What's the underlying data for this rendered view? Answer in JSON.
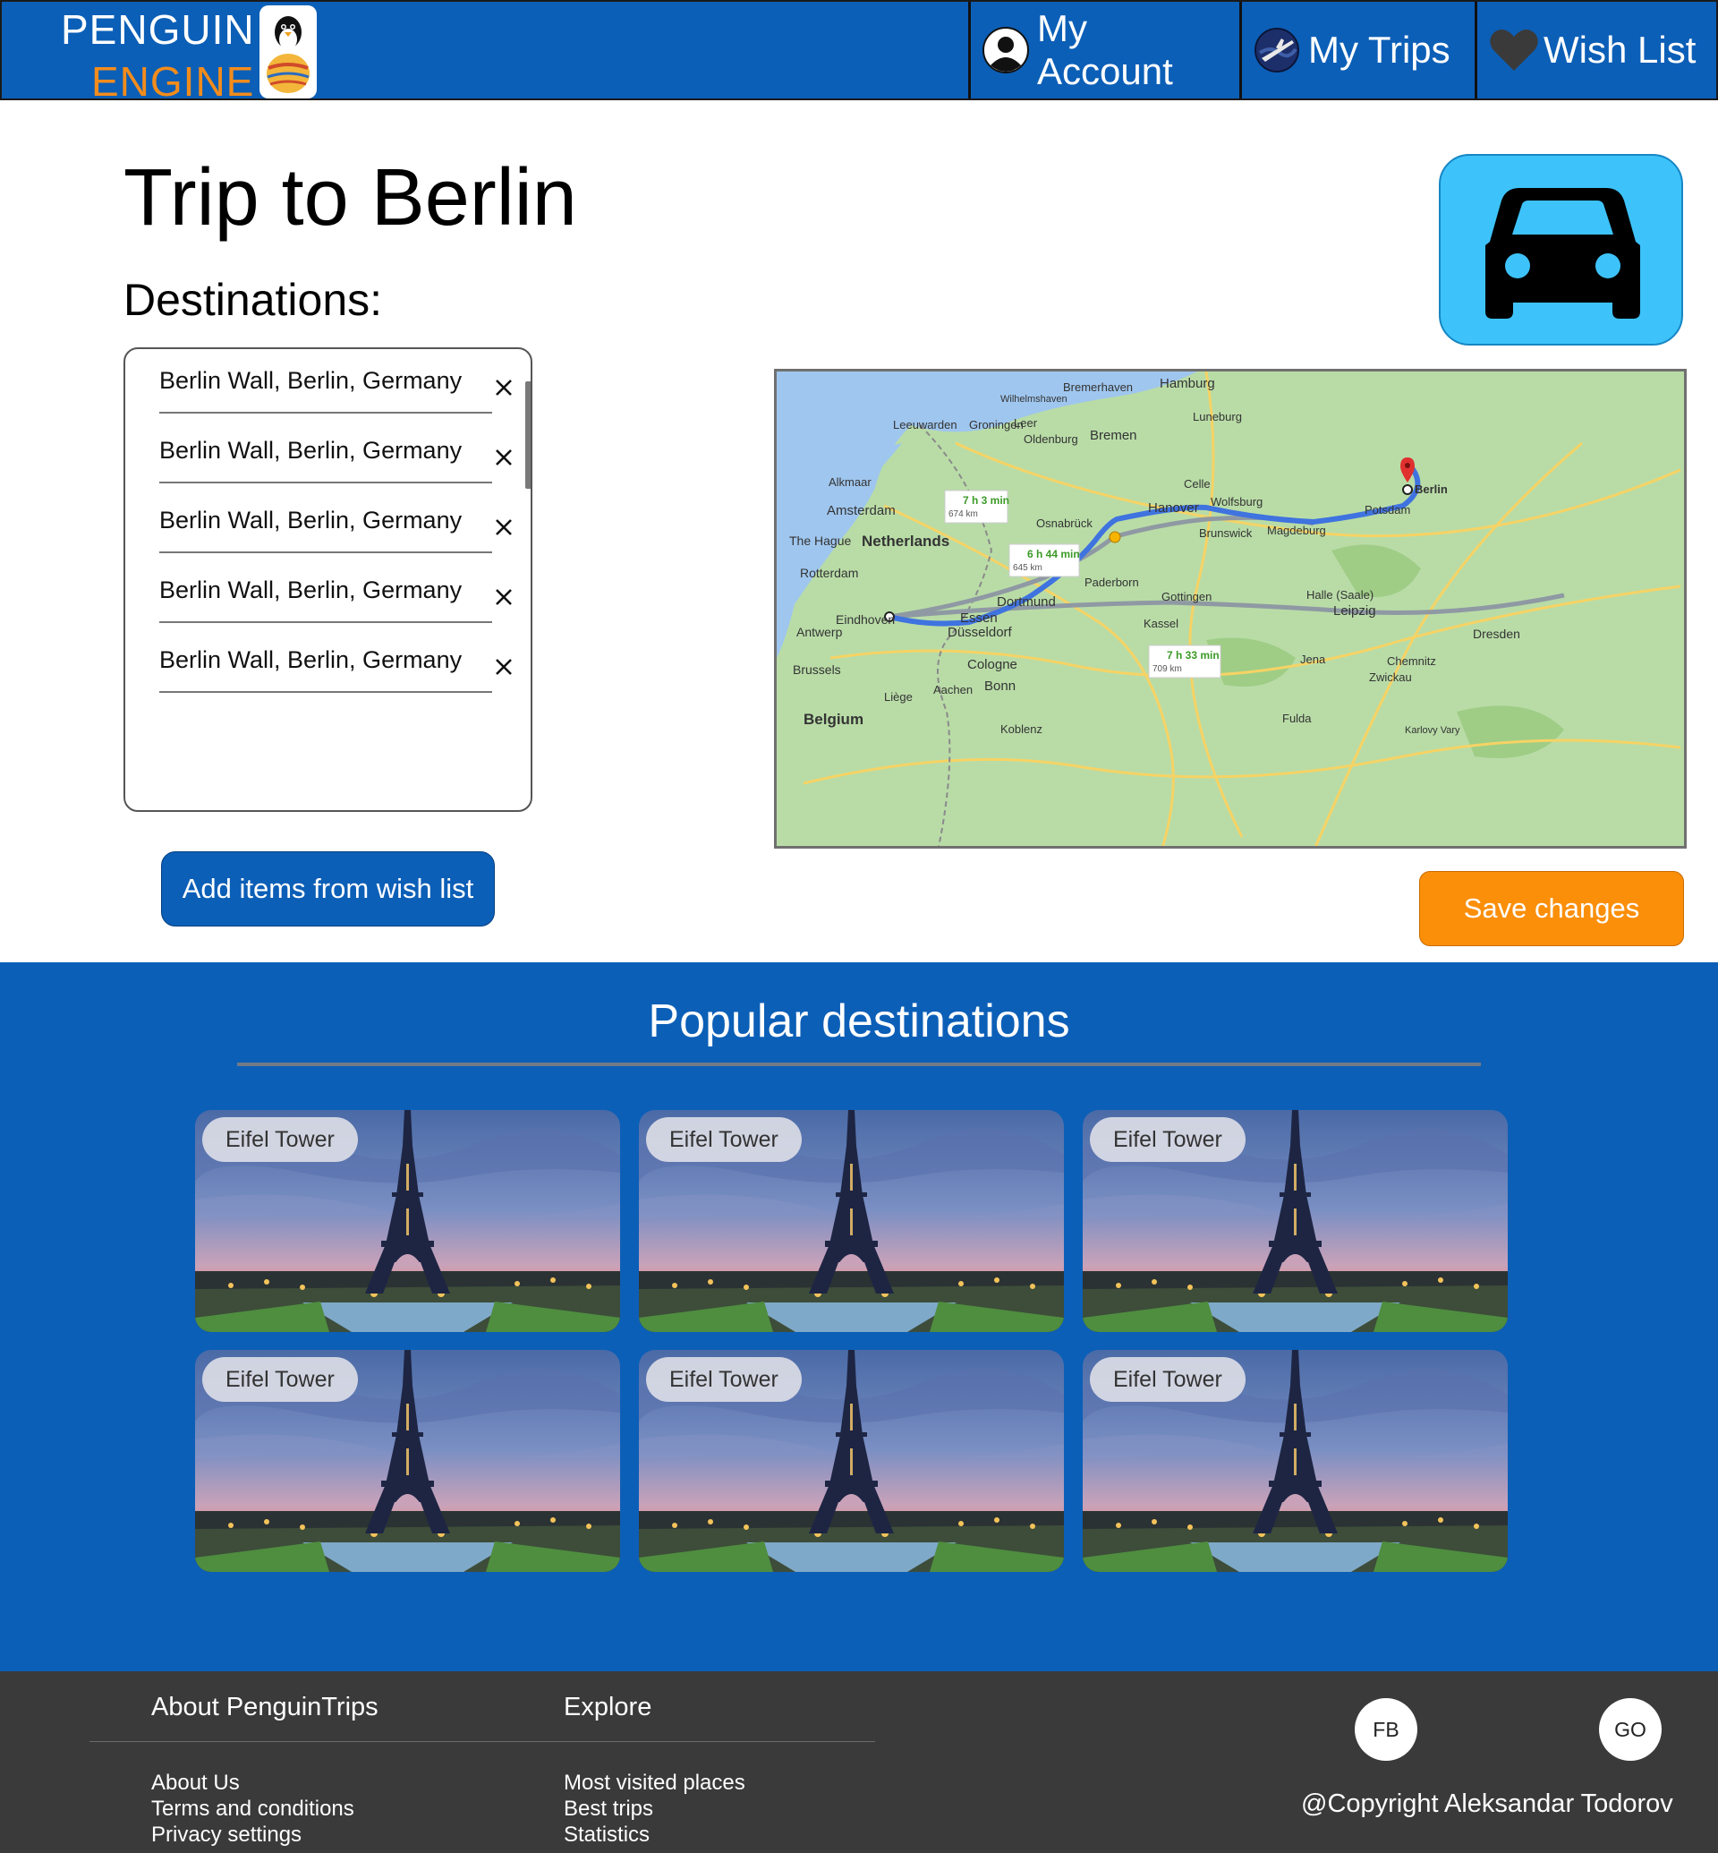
{
  "header": {
    "logo_line1": "PENGUIN",
    "logo_line2": "ENGINE",
    "nav": {
      "account": "My Account",
      "trips": "My Trips",
      "wishlist": "Wish List"
    }
  },
  "trip": {
    "title": "Trip to Berlin",
    "destinations_label": "Destinations:",
    "destinations": [
      "Berlin Wall, Berlin, Germany",
      "Berlin Wall, Berlin, Germany",
      "Berlin Wall, Berlin, Germany",
      "Berlin Wall, Berlin, Germany",
      "Berlin Wall, Berlin, Germany"
    ],
    "transport_icon": "car-icon",
    "add_button": "Add items from wish list",
    "save_button": "Save changes"
  },
  "map": {
    "cities": [
      "Bremerhaven",
      "Hamburg",
      "Groningen",
      "Wilhelmshaven",
      "Leeuwarden",
      "Leer",
      "Oldenburg",
      "Bremen",
      "Luneburg",
      "Alkmaar",
      "Amsterdam",
      "Netherlands",
      "The Hague",
      "Rotterdam",
      "Osnabrück",
      "Celle",
      "Hanover",
      "Wolfsburg",
      "Brunswick",
      "Magdeburg",
      "Potsdam",
      "Berlin",
      "Paderborn",
      "Dortmund",
      "Essen",
      "Düsseldorf",
      "Eindhoven",
      "Antwerp",
      "Gottingen",
      "Halle (Saale)",
      "Leipzig",
      "Kassel",
      "Dresden",
      "Cologne",
      "Bonn",
      "Brussels",
      "Liège",
      "Aachen",
      "Jena",
      "Chemnitz",
      "Zwickau",
      "Belgium",
      "Fulda",
      "Koblenz",
      "Karlovy Vary"
    ],
    "routes": [
      {
        "time": "7 h 3 min",
        "distance": "674 km"
      },
      {
        "time": "6 h 44 min",
        "distance": "645 km"
      },
      {
        "time": "7 h 33 min",
        "distance": "709 km"
      }
    ]
  },
  "popular": {
    "title": "Popular destinations",
    "cards": [
      {
        "label": "Eifel Tower"
      },
      {
        "label": "Eifel Tower"
      },
      {
        "label": "Eifel Tower"
      },
      {
        "label": "Eifel Tower"
      },
      {
        "label": "Eifel Tower"
      },
      {
        "label": "Eifel Tower"
      }
    ]
  },
  "footer": {
    "about_heading": "About PenguinTrips",
    "about_links": [
      "About Us",
      "Terms and conditions",
      "Privacy settings"
    ],
    "explore_heading": "Explore",
    "explore_links": [
      "Most visited places",
      "Best trips",
      "Statistics"
    ],
    "social": [
      "FB",
      "GO"
    ],
    "copyright": "@Copyright Aleksandar Todorov"
  },
  "colors": {
    "brand_blue": "#0c5fb7",
    "accent_orange": "#fb8f0a",
    "car_tile": "#3dc3fa",
    "footer_bg": "#3a3a3a"
  }
}
